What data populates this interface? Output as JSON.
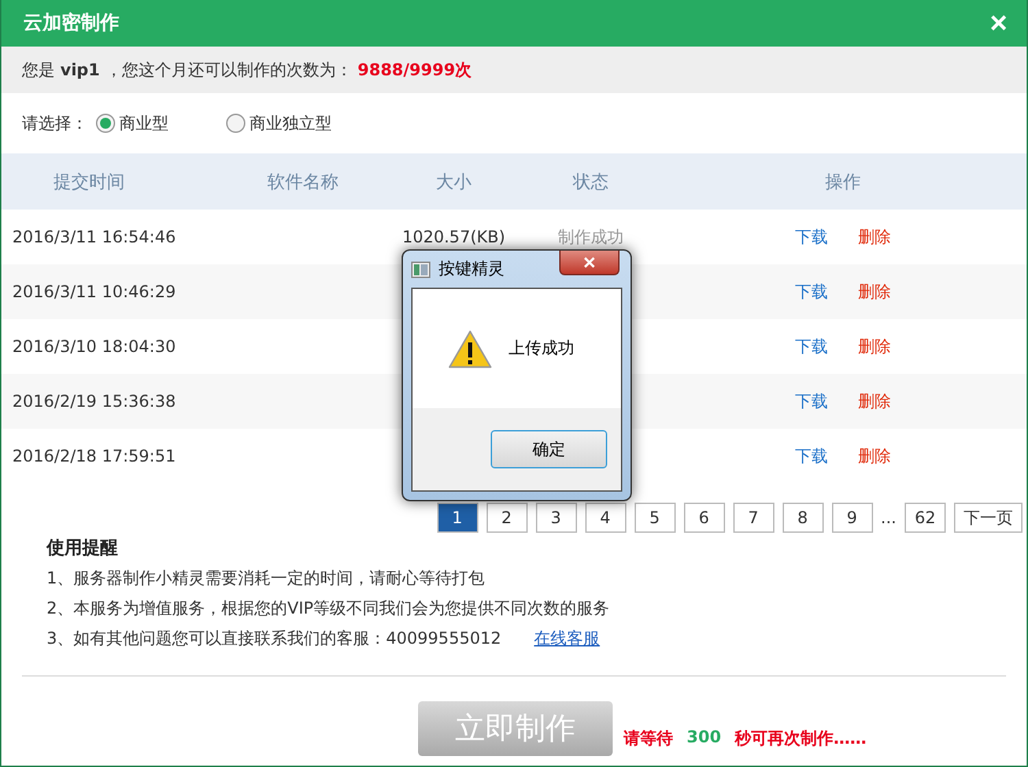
{
  "window": {
    "title": "云加密制作",
    "close": "×"
  },
  "account": {
    "prefix": "您是",
    "level": "vip1",
    "middle": "，您这个月还可以制作的次数为：",
    "count": "9888/9999次"
  },
  "choice": {
    "label": "请选择：",
    "options": [
      {
        "label": "商业型",
        "selected": true
      },
      {
        "label": "商业独立型",
        "selected": false
      }
    ]
  },
  "table": {
    "columns": [
      "提交时间",
      "软件名称",
      "大小",
      "状态",
      "操作"
    ],
    "rows": [
      {
        "time": "2016/3/11 16:54:46",
        "size": "1020.57(KB)",
        "status": "制作成功",
        "download": "下载",
        "delete": "删除"
      },
      {
        "time": "2016/3/11 10:46:29",
        "download": "下载",
        "delete": "删除"
      },
      {
        "time": "2016/3/10 18:04:30",
        "download": "下载",
        "delete": "删除"
      },
      {
        "time": "2016/2/19 15:36:38",
        "download": "下载",
        "delete": "删除"
      },
      {
        "time": "2016/2/18 17:59:51",
        "download": "下载",
        "delete": "删除"
      }
    ]
  },
  "pagination": {
    "pages": [
      {
        "label": "1",
        "selected": true
      },
      {
        "label": "2",
        "selected": false
      },
      {
        "label": "3",
        "selected": false
      },
      {
        "label": "4",
        "selected": false
      },
      {
        "label": "5",
        "selected": false
      },
      {
        "label": "6",
        "selected": false
      },
      {
        "label": "7",
        "selected": false
      },
      {
        "label": "8",
        "selected": false
      },
      {
        "label": "9",
        "selected": false
      }
    ],
    "ellipsis": "...",
    "last": "62",
    "next": "下一页"
  },
  "tips": {
    "title": "使用提醒",
    "lines": [
      "1、服务器制作小精灵需要消耗一定的时间，请耐心等待打包",
      "2、本服务为增值服务，根据您的VIP等级不同我们会为您提供不同次数的服务",
      "3、如有其他问题您可以直接联系我们的客服：40099555012"
    ],
    "link": "在线客服"
  },
  "action": {
    "button": "立即制作",
    "disabled": true,
    "wait_prefix": "请等待",
    "seconds": "300",
    "wait_suffix": "秒可再次制作……"
  },
  "dialog": {
    "title": "按键精灵",
    "close": "✕",
    "message": "上传成功",
    "ok": "确定"
  }
}
